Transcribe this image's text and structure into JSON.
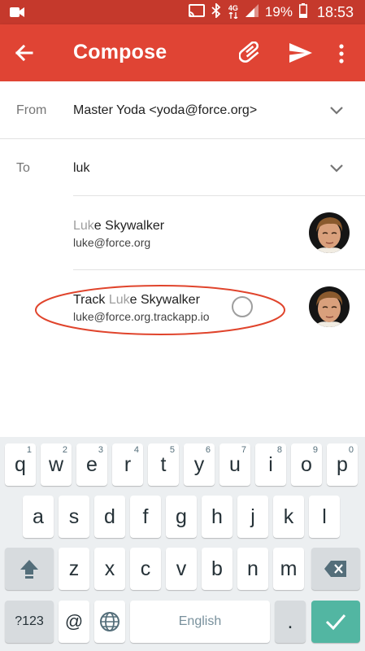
{
  "status_bar": {
    "signal_type": "4G",
    "battery": "19%",
    "time": "18:53",
    "icons": [
      "video-camera-icon",
      "cast-icon",
      "bluetooth-icon",
      "network-4g-icon",
      "signal-strength-icon",
      "battery-icon"
    ]
  },
  "app_bar": {
    "title": "Compose",
    "icons": [
      "back-arrow-icon",
      "attachment-icon",
      "send-icon",
      "more-vert-icon"
    ],
    "color": "#e04434"
  },
  "from": {
    "label": "From",
    "value": "Master Yoda <yoda@force.org>"
  },
  "to": {
    "label": "To",
    "value": "luk"
  },
  "suggestions": [
    {
      "name_match": "Luk",
      "name_rest": "e Skywalker",
      "email": "luke@force.org"
    },
    {
      "name_prefix": "Track ",
      "name_match": "Luk",
      "name_rest": "e Skywalker",
      "email": "luke@force.org.trackapp.io"
    }
  ],
  "keyboard": {
    "row1": [
      {
        "key": "q",
        "hint": "1"
      },
      {
        "key": "w",
        "hint": "2"
      },
      {
        "key": "e",
        "hint": "3"
      },
      {
        "key": "r",
        "hint": "4"
      },
      {
        "key": "t",
        "hint": "5"
      },
      {
        "key": "y",
        "hint": "6"
      },
      {
        "key": "u",
        "hint": "7"
      },
      {
        "key": "i",
        "hint": "8"
      },
      {
        "key": "o",
        "hint": "9"
      },
      {
        "key": "p",
        "hint": "0"
      }
    ],
    "row2": [
      "a",
      "s",
      "d",
      "f",
      "g",
      "h",
      "j",
      "k",
      "l"
    ],
    "row3": [
      "z",
      "x",
      "c",
      "v",
      "b",
      "n",
      "m"
    ],
    "symbols_key": "?123",
    "at_key": "@",
    "space_label": "English",
    "period_key": ".",
    "accent_color": "#52b6a2"
  }
}
